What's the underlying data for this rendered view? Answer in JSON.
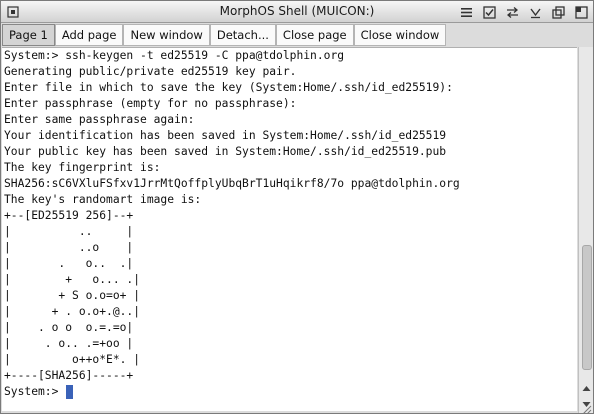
{
  "window": {
    "title": "MorphOS Shell (MUICON:)",
    "gadgets": [
      "menu-icon",
      "checkbox-icon",
      "swap-icon",
      "dropdown-icon",
      "iconify-icon",
      "zoom-icon"
    ]
  },
  "toolbar": {
    "buttons": [
      {
        "label": "Page 1",
        "active": true
      },
      {
        "label": "Add page"
      },
      {
        "label": "New window"
      },
      {
        "label": "Detach..."
      },
      {
        "label": "Close page"
      },
      {
        "label": "Close window"
      }
    ]
  },
  "terminal": {
    "lines": [
      "System:> ssh-keygen -t ed25519 -C ppa@tdolphin.org",
      "Generating public/private ed25519 key pair.",
      "Enter file in which to save the key (System:Home/.ssh/id_ed25519):",
      "Enter passphrase (empty for no passphrase):",
      "Enter same passphrase again:",
      "Your identification has been saved in System:Home/.ssh/id_ed25519",
      "Your public key has been saved in System:Home/.ssh/id_ed25519.pub",
      "The key fingerprint is:",
      "SHA256:sC6VXluFSfxv1JrrMtQoffplyUbqBrT1uHqikrf8/7o ppa@tdolphin.org",
      "The key's randomart image is:",
      "+--[ED25519 256]--+",
      "|          ..     |",
      "|          ..o    |",
      "|       .   o..  .|",
      "|        +   o... .|",
      "|       + S o.o=o+ |",
      "|      + . o.o+.@..|",
      "|    . o o  o.=.=o|",
      "|     . o.. .=+oo |",
      "|         o++o*E*. |",
      "+----[SHA256]-----+"
    ],
    "prompt": "System:>"
  },
  "colors": {
    "cursor": "#3a62b8",
    "terminal_bg": "#ffffff",
    "window_bg": "#dcdcdc"
  }
}
